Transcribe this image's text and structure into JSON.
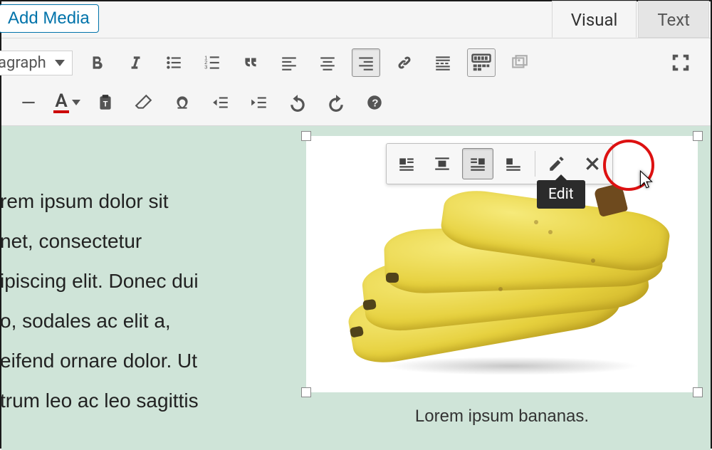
{
  "header": {
    "add_media": "Add Media",
    "tabs": {
      "visual": "Visual",
      "text": "Text"
    }
  },
  "toolbar": {
    "format_label": "agraph",
    "row1_icons": [
      "bold",
      "italic",
      "ul",
      "ol",
      "quote",
      "align-left",
      "align-center",
      "align-right",
      "link",
      "more",
      "kitchen-sink",
      "gallery",
      "fullscreen"
    ],
    "row2_icons": [
      "hr",
      "text-color",
      "paste-text",
      "clear",
      "special-char",
      "outdent",
      "indent",
      "undo",
      "redo",
      "help"
    ]
  },
  "content": {
    "paragraph_lines": [
      "rem ipsum dolor sit",
      "net, consectetur",
      "ipiscing elit. Donec dui",
      "o, sodales ac elit a,",
      "eifend ornare dolor. Ut",
      "trum leo ac leo sagittis"
    ],
    "image": {
      "caption": "Lorem ipsum bananas.",
      "alt": "bananas",
      "align_buttons": [
        "align-left",
        "align-center",
        "align-right",
        "align-none"
      ],
      "selected_align": "align-right",
      "actions": [
        "edit",
        "remove"
      ],
      "tooltip": "Edit"
    }
  }
}
